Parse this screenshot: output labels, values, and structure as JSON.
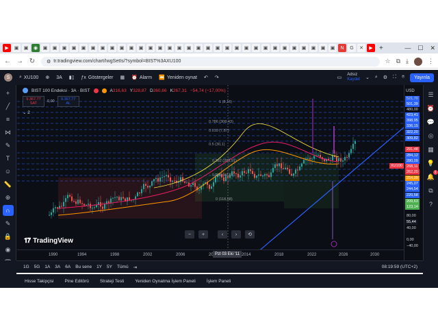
{
  "browser": {
    "tab_icons": [
      "yt",
      "doc",
      "doc",
      "wa",
      "doc",
      "doc",
      "doc",
      "doc",
      "doc",
      "doc",
      "doc",
      "doc",
      "doc",
      "doc",
      "doc",
      "doc",
      "doc",
      "doc",
      "doc",
      "doc",
      "doc",
      "doc",
      "doc",
      "doc",
      "doc",
      "doc",
      "doc",
      "doc",
      "doc",
      "doc",
      "doc",
      "doc",
      "doc",
      "doc",
      "doc",
      "netflix",
      "google",
      "close",
      "yt"
    ],
    "new_tab": "+",
    "url": "tr.tradingview.com/chart/IwgSetIs/?symbol=BIST%3AXU100",
    "win_min": "—",
    "win_max": "☐",
    "win_close": "✕"
  },
  "tv_header": {
    "avatar_letter": "S",
    "symbol": "XU100",
    "interval": "3A",
    "indicators_label": "Göstergeler",
    "alert_label": "Alarm",
    "replay_label": "Yeniden oynat",
    "user_name": "Adsız",
    "user_sub": "Kaydet",
    "publish_label": "Yayınla"
  },
  "legend": {
    "title": "BIST 100 Endeksi · 3A · BIST",
    "o_label": "A",
    "o_value": "316,63",
    "h_label": "Y",
    "h_value": "328,87",
    "l_label": "D",
    "l_value": "260,66",
    "c_label": "K",
    "c_value": "267,31",
    "change": "−54,74 (−17,00%)",
    "sell_price": "9.367,77",
    "sell_label": "SAT",
    "spread": "0,00",
    "buy_price": "9.367,77",
    "buy_label": "AL",
    "indicator_count": "2"
  },
  "watermark": "TradingView",
  "zoom_controls": [
    "−",
    "+",
    "‹",
    "›",
    "⟲"
  ],
  "price_axis": {
    "currency": "USD",
    "labels": [
      {
        "text": "521,70",
        "color": "#d1d4dc",
        "bg": "#2962ff"
      },
      {
        "text": "501,39",
        "color": "#ffffff",
        "bg": "#2962ff"
      },
      {
        "text": "480,00",
        "color": "#d1d4dc",
        "bg": ""
      },
      {
        "text": "423,41",
        "color": "#ffffff",
        "bg": "#2962ff"
      },
      {
        "text": "398,95",
        "color": "#ffffff",
        "bg": "#2962ff"
      },
      {
        "text": "336,15",
        "color": "#ffffff",
        "bg": "#2962ff"
      },
      {
        "text": "322,20",
        "color": "#ffffff",
        "bg": "#2962ff"
      },
      {
        "text": "309,82",
        "color": "#ffffff",
        "bg": "#2962ff"
      },
      {
        "text": "291,48",
        "color": "#ffffff",
        "bg": "#f23645"
      },
      {
        "text": "284,12",
        "color": "#ffffff",
        "bg": "#2962ff"
      },
      {
        "text": "280,09",
        "color": "#ffffff",
        "bg": "#2962ff"
      },
      {
        "text": "268,11",
        "color": "#ffffff",
        "bg": "#f23645"
      },
      {
        "text": "262,20",
        "color": "#ffffff",
        "bg": "#f23645"
      },
      {
        "text": "254,99",
        "color": "#ffffff",
        "bg": "#ff9800"
      },
      {
        "text": "245,07",
        "color": "#ffffff",
        "bg": "#2962ff"
      },
      {
        "text": "244,54",
        "color": "#ffffff",
        "bg": "#2962ff"
      },
      {
        "text": "220,58",
        "color": "#ffffff",
        "bg": "#2962ff"
      },
      {
        "text": "209,63",
        "color": "#ffffff",
        "bg": "#4caf50"
      },
      {
        "text": "123,14",
        "color": "#ffffff",
        "bg": "#4caf50"
      },
      {
        "text": "80,00",
        "color": "#d1d4dc",
        "bg": ""
      },
      {
        "text": "55,44",
        "color": "#ffffff",
        "bg": "#131722"
      },
      {
        "text": "40,00",
        "color": "#d1d4dc",
        "bg": ""
      },
      {
        "text": "0,00",
        "color": "#d1d4dc",
        "bg": ""
      },
      {
        "text": "−40,00",
        "color": "#d1d4dc",
        "bg": ""
      }
    ],
    "symbol_tag": "XU100"
  },
  "fib_labels": [
    {
      "text": "1 (8,16)"
    },
    {
      "text": "0.786 (308,43)"
    },
    {
      "text": "0.618 (7,87)"
    },
    {
      "text": "0.5 (30,1)"
    },
    {
      "text": "0.382 (263,91)"
    },
    {
      "text": "0.236 (40,51)"
    },
    {
      "text": "0 (118,58)"
    }
  ],
  "time_axis": {
    "labels": [
      "1990",
      "1994",
      "1998",
      "2002",
      "2006",
      "20",
      "2014",
      "2018",
      "2022",
      "2026",
      "2030"
    ],
    "hover_label": "Pzt 03 Eki '11"
  },
  "range_bar": {
    "items": [
      "1G",
      "5G",
      "1A",
      "3A",
      "6A",
      "Bu sene",
      "1Y",
      "5Y",
      "Tümü"
    ],
    "clock": "08:19:59 (UTC+2)"
  },
  "panels": [
    "Hisse Takipçisi",
    "Pine Editörü",
    "Strateji Testi",
    "Yeniden Oynatma İşlem Paneli",
    "İşlem Paneli"
  ]
}
